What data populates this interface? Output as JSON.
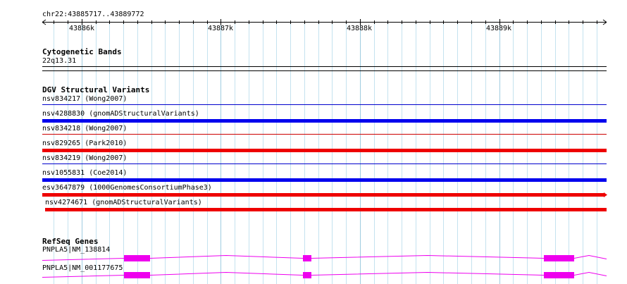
{
  "ruler": {
    "location": "chr22:43885717..43889772",
    "ticks": [
      {
        "label": "43886k",
        "pos": 43886000
      },
      {
        "label": "43887k",
        "pos": 43887000
      },
      {
        "label": "43888k",
        "pos": 43888000
      },
      {
        "label": "43889k",
        "pos": 43889000
      }
    ],
    "start": 43885717,
    "end": 43889772
  },
  "tracks": {
    "cytoband": {
      "title": "Cytogenetic Bands",
      "band_label": "22q13.31"
    },
    "dgv": {
      "title": "DGV Structural Variants",
      "features": [
        {
          "label": "nsv834217 (Wong2007)",
          "color": "#0000cc",
          "style": "thin"
        },
        {
          "label": "nsv4288830 (gnomADStructuralVariants)",
          "color": "#0000ee",
          "style": "thick"
        },
        {
          "label": "nsv834218 (Wong2007)",
          "color": "#cc0000",
          "style": "thin"
        },
        {
          "label": "nsv829265 (Park2010)",
          "color": "#ee0000",
          "style": "thick"
        },
        {
          "label": "nsv834219 (Wong2007)",
          "color": "#0000cc",
          "style": "thin"
        },
        {
          "label": "nsv1055831 (Coe2014)",
          "color": "#0000ee",
          "style": "thick"
        },
        {
          "label": "esv3647879 (1000GenomesConsortiumPhase3)",
          "color": "#ee0000",
          "style": "thick-arrow"
        },
        {
          "label": "nsv4274671 (gnomADStructuralVariants)",
          "color": "#ee0000",
          "style": "thick-offset"
        }
      ]
    },
    "refseq": {
      "title": "RefSeq Genes",
      "color": "#ee00ee",
      "genes": [
        {
          "label": "PNPLA5|NM_138814"
        },
        {
          "label": "PNPLA5|NM_001177675"
        }
      ]
    }
  }
}
